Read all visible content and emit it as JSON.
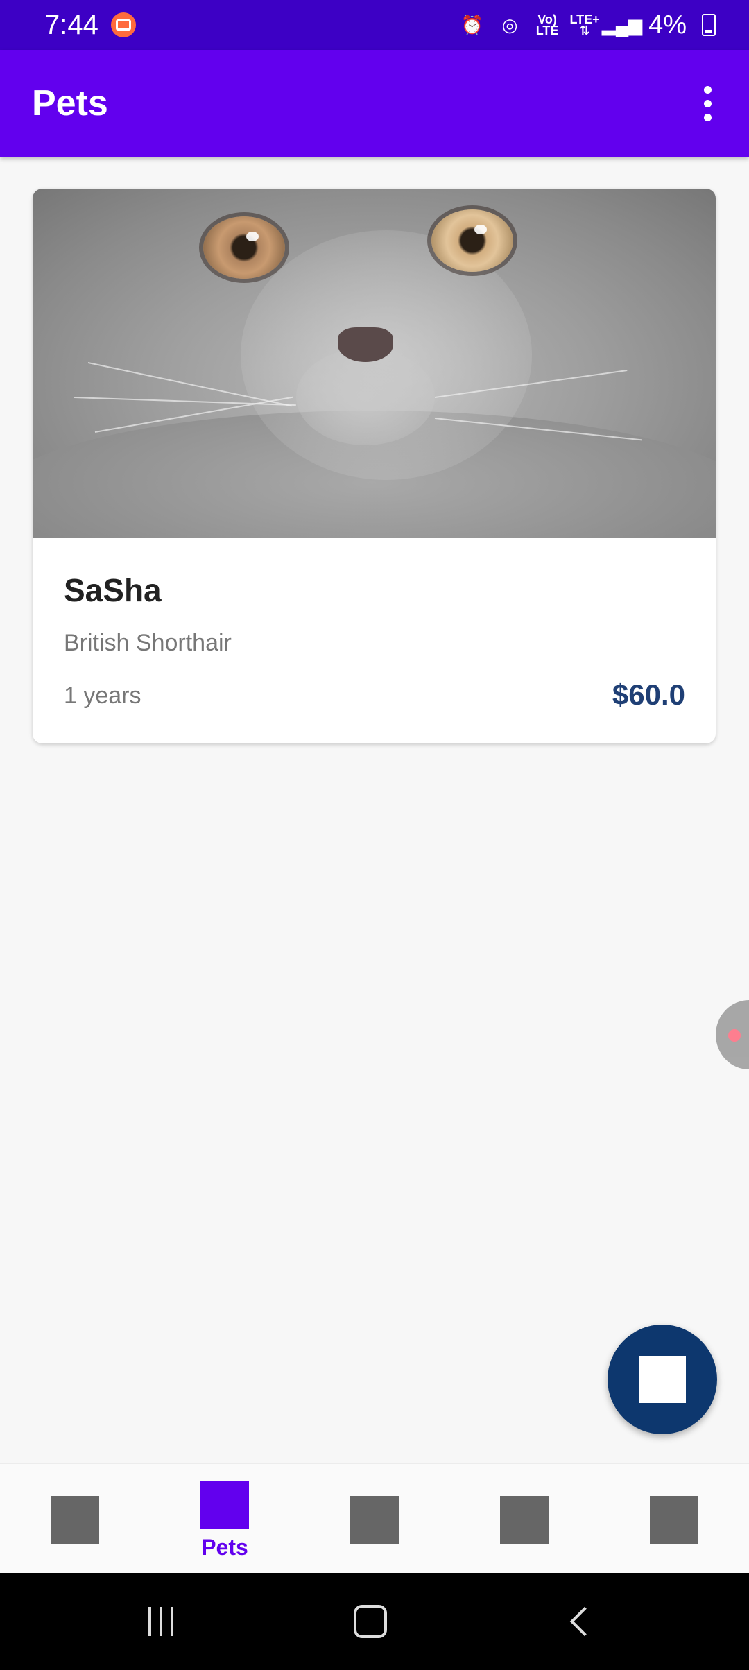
{
  "status_bar": {
    "time": "7:44",
    "battery": "4%",
    "volte": "Vo))",
    "lte": "LTE"
  },
  "app_bar": {
    "title": "Pets"
  },
  "pet_card": {
    "name": "SaSha",
    "breed": "British Shorthair",
    "age": "1 years",
    "price": "$60.0"
  },
  "bottom_nav": {
    "items": [
      {
        "label": "",
        "active": false
      },
      {
        "label": "Pets",
        "active": true
      },
      {
        "label": "",
        "active": false
      },
      {
        "label": "",
        "active": false
      },
      {
        "label": "",
        "active": false
      }
    ]
  },
  "colors": {
    "primary": "#6200ee",
    "status_bar": "#3d00c5",
    "fab": "#0d376e",
    "price": "#1f3f75"
  }
}
